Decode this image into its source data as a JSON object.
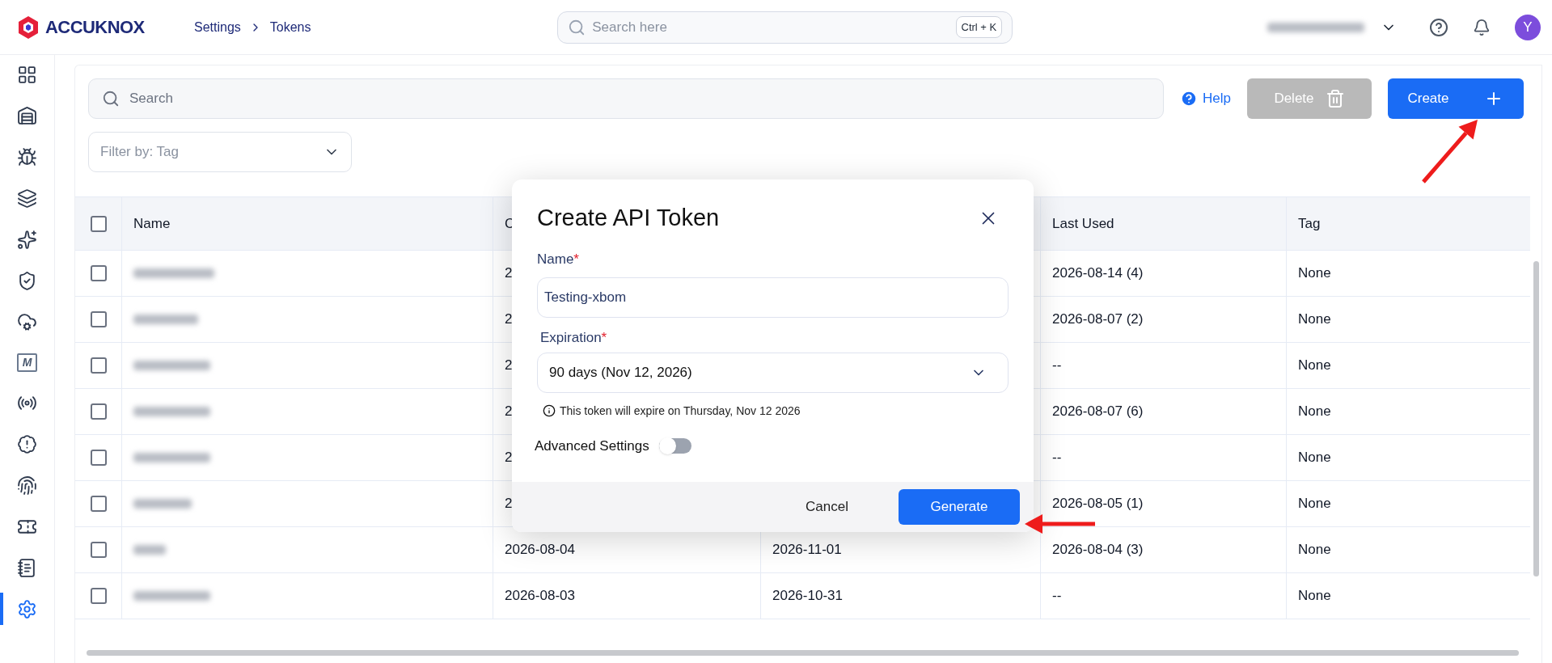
{
  "logo": {
    "text": "ACCUKNOX"
  },
  "breadcrumb": [
    "Settings",
    "Tokens"
  ],
  "global_search": {
    "placeholder": "Search here",
    "shortcut": "Ctrl + K"
  },
  "avatar": {
    "initial": "Y"
  },
  "sidebar": {
    "items": [
      {
        "selected": false
      },
      {
        "selected": false
      },
      {
        "selected": false
      },
      {
        "selected": false
      },
      {
        "selected": false
      },
      {
        "selected": false
      },
      {
        "selected": false
      },
      {
        "selected": false,
        "label": "M"
      },
      {
        "selected": false
      },
      {
        "selected": false
      },
      {
        "selected": false
      },
      {
        "selected": false
      },
      {
        "selected": false
      },
      {
        "selected": true
      }
    ]
  },
  "toolbar": {
    "search": {
      "placeholder": "Search"
    },
    "help": "Help",
    "delete": {
      "label": "Delete",
      "disabled": true
    },
    "create": {
      "label": "Create"
    },
    "filter": {
      "placeholder": "Filter by: Tag"
    }
  },
  "table": {
    "header": {
      "checked": false,
      "name": "Name",
      "column_2": "C",
      "last_used": "Last Used",
      "tag": "Tag"
    },
    "rows": [
      {
        "checked": false,
        "column_2": "2",
        "last_used": "2026-08-14 (4)",
        "tag": "None"
      },
      {
        "checked": false,
        "column_2": "2",
        "last_used": "2026-08-07 (2)",
        "tag": "None"
      },
      {
        "checked": false,
        "column_2": "2",
        "last_used": "--",
        "tag": "None"
      },
      {
        "checked": false,
        "column_2": "2",
        "last_used": "2026-08-07 (6)",
        "tag": "None"
      },
      {
        "checked": false,
        "column_2": "2",
        "last_used": "--",
        "tag": "None"
      },
      {
        "checked": false,
        "column_2": "2",
        "last_used": "2026-08-05 (1)",
        "tag": "None"
      },
      {
        "checked": false,
        "column_2": "2026-08-04",
        "column_3": "2026-11-01",
        "last_used": "2026-08-04 (3)",
        "tag": "None"
      },
      {
        "checked": false,
        "column_2": "2026-08-03",
        "column_3": "2026-10-31",
        "last_used": "--",
        "tag": "None"
      }
    ]
  },
  "dialog": {
    "title": "Create API Token",
    "name": {
      "label": "Name",
      "required": true,
      "required_mark": "*",
      "value": "Testing-xbom"
    },
    "expiration": {
      "label": "Expiration",
      "required": true,
      "required_mark": "*",
      "value": "90 days (Nov 12, 2026)"
    },
    "info": "This token will expire on Thursday, Nov 12 2026",
    "advanced": {
      "label": "Advanced Settings",
      "on": false
    },
    "cancel": "Cancel",
    "generate": "Generate"
  }
}
